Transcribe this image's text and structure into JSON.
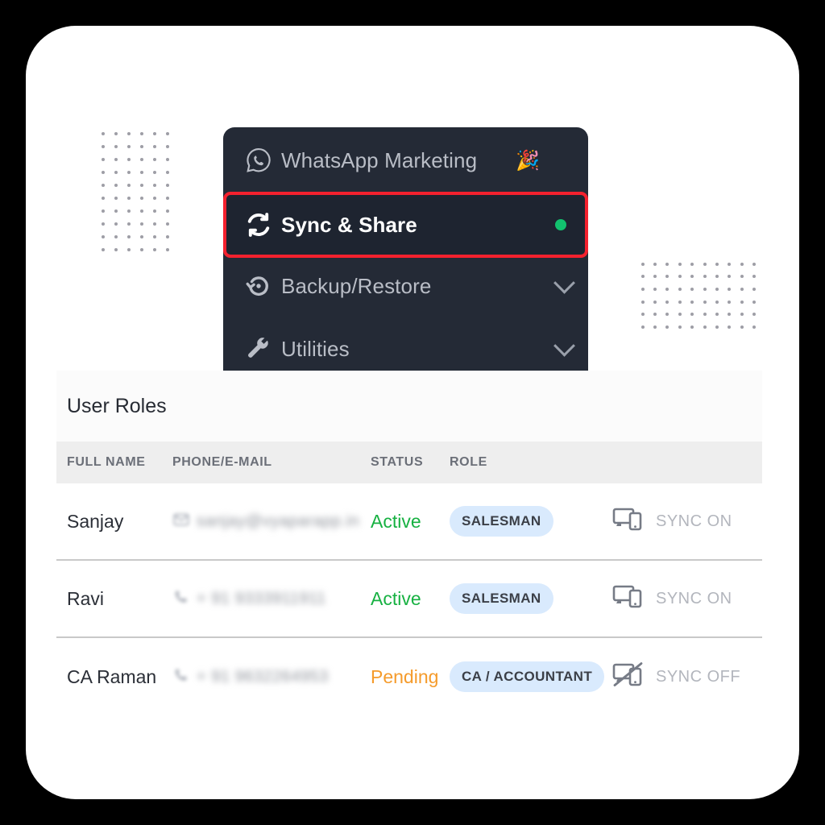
{
  "menu": {
    "items": [
      {
        "label": "WhatsApp Marketing",
        "emoji": "🎉",
        "icon": "whatsapp-icon",
        "trailing": "none",
        "active": false
      },
      {
        "label": "Sync & Share",
        "emoji": "",
        "icon": "sync-refresh-icon",
        "trailing": "green-status-dot",
        "active": true
      },
      {
        "label": "Backup/Restore",
        "emoji": "",
        "icon": "restore-icon",
        "trailing": "chevron-down-icon",
        "active": false
      },
      {
        "label": "Utilities",
        "emoji": "",
        "icon": "wrench-icon",
        "trailing": "chevron-down-icon",
        "active": false
      }
    ],
    "highlight_color": "#f4212e",
    "status_dot_color": "#12c16e",
    "panel_color": "#242a36"
  },
  "table": {
    "title": "User Roles",
    "columns": [
      "FULL NAME",
      "PHONE/E-MAIL",
      "STATUS",
      "ROLE",
      ""
    ],
    "rows": [
      {
        "name": "Sanjay",
        "contact": "sanjay@vyaparapp.in",
        "contact_icon": "email-icon",
        "status": "Active",
        "status_color": "#17b142",
        "role": "SALESMAN",
        "sync_label": "SYNC ON",
        "sync_icon": "devices-sync-on-icon"
      },
      {
        "name": "Ravi",
        "contact": "+ 91 9333911911",
        "contact_icon": "phone-icon",
        "status": "Active",
        "status_color": "#17b142",
        "role": "SALESMAN",
        "sync_label": "SYNC ON",
        "sync_icon": "devices-sync-on-icon"
      },
      {
        "name": "CA Raman",
        "contact": "+ 91 9632264953",
        "contact_icon": "phone-icon",
        "status": "Pending",
        "status_color": "#f59b2b",
        "role": "CA / ACCOUNTANT",
        "sync_label": "SYNC OFF",
        "sync_icon": "devices-sync-off-icon"
      }
    ],
    "role_badge_color": "#d9eafd"
  }
}
